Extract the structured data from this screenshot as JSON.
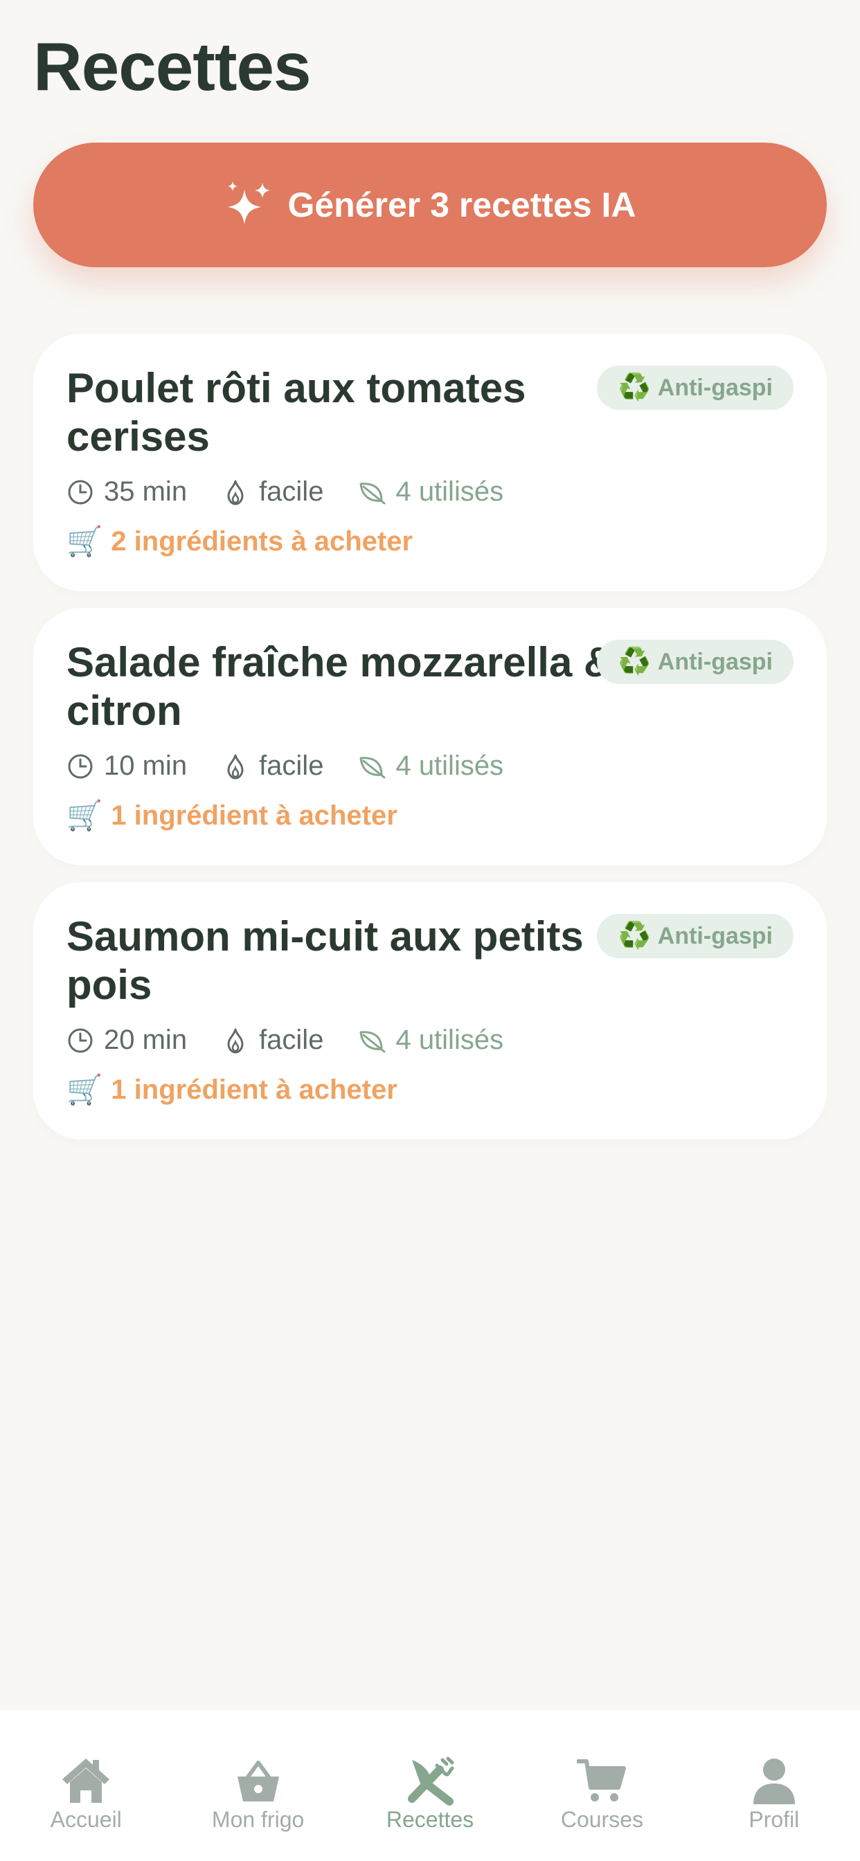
{
  "page": {
    "title": "Recettes"
  },
  "generate_button": {
    "label": "Générer 3 recettes IA"
  },
  "recipes": [
    {
      "title": "Poulet rôti aux tomates cerises",
      "badge": "Anti-gaspi",
      "time": "35 min",
      "difficulty": "facile",
      "used": "4 utilisés",
      "to_buy": "2 ingrédients à acheter"
    },
    {
      "title": "Salade fraîche mozzarella & citron",
      "badge": "Anti-gaspi",
      "time": "10 min",
      "difficulty": "facile",
      "used": "4 utilisés",
      "to_buy": "1 ingrédient à acheter"
    },
    {
      "title": "Saumon mi-cuit aux petits pois",
      "badge": "Anti-gaspi",
      "time": "20 min",
      "difficulty": "facile",
      "used": "4 utilisés",
      "to_buy": "1 ingrédient à acheter"
    }
  ],
  "icons": {
    "badge": "♻️",
    "cart": "🛒"
  },
  "nav": {
    "items": [
      {
        "label": "Accueil",
        "icon": "home-icon"
      },
      {
        "label": "Mon frigo",
        "icon": "basket-icon"
      },
      {
        "label": "Recettes",
        "icon": "utensils-icon",
        "active": true
      },
      {
        "label": "Courses",
        "icon": "cart-icon"
      },
      {
        "label": "Profil",
        "icon": "user-icon"
      }
    ]
  },
  "colors": {
    "accent": "#e07a60",
    "green": "#86a68d",
    "orange": "#f0a262",
    "dark": "#2b3a31",
    "background": "#f8f7f4"
  }
}
